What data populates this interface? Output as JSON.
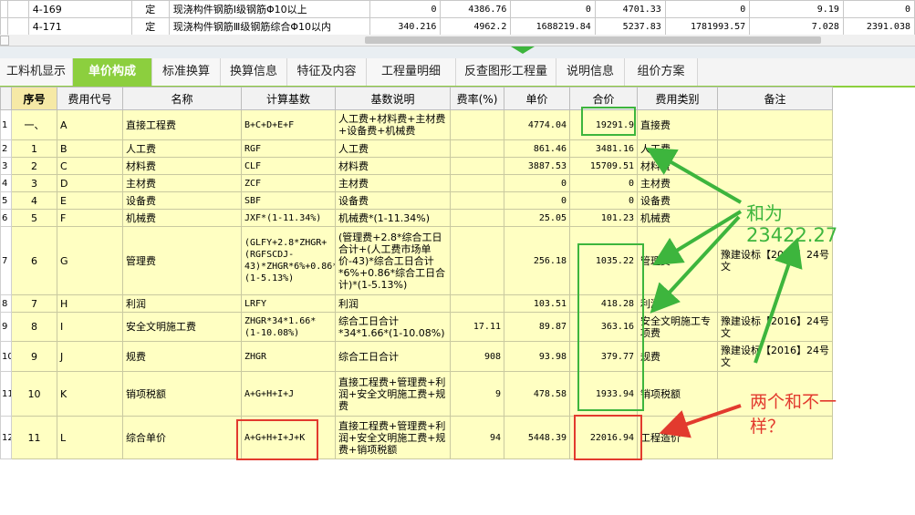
{
  "top_rows": [
    {
      "code": "4-169",
      "type": "定",
      "name": "现浇构件钢筋Ⅰ级钢筋Φ10以上",
      "v1": "0",
      "v2": "4386.76",
      "v3": "0",
      "v4": "4701.33",
      "v5": "0",
      "v6": "9.19",
      "v7": "0"
    },
    {
      "code": "4-171",
      "type": "定",
      "name": "现浇构件钢筋Ⅲ级钢筋综合Φ10以内",
      "v1": "340.216",
      "v2": "4962.2",
      "v3": "1688219.84",
      "v4": "5237.83",
      "v5": "1781993.57",
      "v6": "7.028",
      "v7": "2391.038"
    }
  ],
  "tabs": [
    "工料机显示",
    "单价构成",
    "标准换算",
    "换算信息",
    "特征及内容",
    "工程量明细",
    "反查图形工程量",
    "说明信息",
    "组价方案"
  ],
  "active_tab": "单价构成",
  "columns": [
    "序号",
    "费用代号",
    "名称",
    "计算基数",
    "基数说明",
    "费率(%)",
    "单价",
    "合价",
    "费用类别",
    "备注"
  ],
  "rows": [
    {
      "rn": "1",
      "seq": "一、",
      "code": "A",
      "name": "直接工程费",
      "base": "B+C+D+E+F",
      "desc": "人工费+材料费+主材费+设备费+机械费",
      "rate": "",
      "price": "4774.04",
      "total": "19291.9",
      "cat": "直接费",
      "note": ""
    },
    {
      "rn": "2",
      "seq": "1",
      "code": "B",
      "name": "人工费",
      "base": "RGF",
      "desc": "人工费",
      "rate": "",
      "price": "861.46",
      "total": "3481.16",
      "cat": "人工费",
      "note": ""
    },
    {
      "rn": "3",
      "seq": "2",
      "code": "C",
      "name": "材料费",
      "base": "CLF",
      "desc": "材料费",
      "rate": "",
      "price": "3887.53",
      "total": "15709.51",
      "cat": "材料费",
      "note": ""
    },
    {
      "rn": "4",
      "seq": "3",
      "code": "D",
      "name": "主材费",
      "base": "ZCF",
      "desc": "主材费",
      "rate": "",
      "price": "0",
      "total": "0",
      "cat": "主材费",
      "note": ""
    },
    {
      "rn": "5",
      "seq": "4",
      "code": "E",
      "name": "设备费",
      "base": "SBF",
      "desc": "设备费",
      "rate": "",
      "price": "0",
      "total": "0",
      "cat": "设备费",
      "note": ""
    },
    {
      "rn": "6",
      "seq": "5",
      "code": "F",
      "name": "机械费",
      "base": "JXF*(1-11.34%)",
      "desc": "机械费*(1-11.34%)",
      "rate": "",
      "price": "25.05",
      "total": "101.23",
      "cat": "机械费",
      "note": ""
    },
    {
      "rn": "7",
      "seq": "6",
      "code": "G",
      "name": "管理费",
      "base": "(GLFY+2.8*ZHGR+(RGFSCDJ-43)*ZHGR*6%+0.86*ZHGR)*(1-5.13%)",
      "desc": "(管理费+2.8*综合工日合计+(人工费市场单价-43)*综合工日合计*6%+0.86*综合工日合计)*(1-5.13%)",
      "rate": "",
      "price": "256.18",
      "total": "1035.22",
      "cat": "管理费",
      "note": "豫建设标【2016】24号文"
    },
    {
      "rn": "8",
      "seq": "7",
      "code": "H",
      "name": "利润",
      "base": "LRFY",
      "desc": "利润",
      "rate": "",
      "price": "103.51",
      "total": "418.28",
      "cat": "利润",
      "note": ""
    },
    {
      "rn": "9",
      "seq": "8",
      "code": "I",
      "name": "安全文明施工费",
      "base": "ZHGR*34*1.66*(1-10.08%)",
      "desc": "综合工日合计*34*1.66*(1-10.08%)",
      "rate": "17.11",
      "price": "89.87",
      "total": "363.16",
      "cat": "安全文明施工专项费",
      "note": "豫建设标【2016】24号文"
    },
    {
      "rn": "10",
      "seq": "9",
      "code": "J",
      "name": "规费",
      "base": "ZHGR",
      "desc": "综合工日合计",
      "rate": "908",
      "price": "93.98",
      "total": "379.77",
      "cat": "规费",
      "note": "豫建设标【2016】24号文"
    },
    {
      "rn": "11",
      "seq": "10",
      "code": "K",
      "name": "销项税额",
      "base": "A+G+H+I+J",
      "desc": "直接工程费+管理费+利润+安全文明施工费+规费",
      "rate": "9",
      "price": "478.58",
      "total": "1933.94",
      "cat": "销项税额",
      "note": ""
    },
    {
      "rn": "12",
      "seq": "11",
      "code": "L",
      "name": "综合单价",
      "base": "A+G+H+I+J+K",
      "desc": "直接工程费+管理费+利润+安全文明施工费+规费+销项税额",
      "rate": "94",
      "price": "5448.39",
      "total": "22016.94",
      "cat": "工程造价",
      "note": ""
    }
  ],
  "annotations": {
    "sum_label": "和为",
    "sum_value": "23422.27",
    "question": "两个和不一样？",
    "green": "#3db53d",
    "red": "#e23a2e"
  }
}
